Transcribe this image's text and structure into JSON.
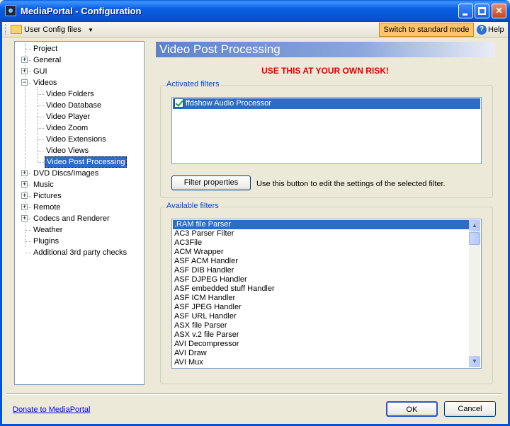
{
  "window": {
    "title": "MediaPortal - Configuration"
  },
  "toolbar": {
    "user_config": "User Config files",
    "switch_mode": "Switch to standard mode",
    "help": "Help"
  },
  "tree": {
    "items": [
      {
        "label": "Project",
        "expander": ""
      },
      {
        "label": "General",
        "expander": "+"
      },
      {
        "label": "GUI",
        "expander": "+"
      },
      {
        "label": "Videos",
        "expander": "−"
      },
      {
        "label": "Video Folders",
        "expander": ""
      },
      {
        "label": "Video Database",
        "expander": ""
      },
      {
        "label": "Video Player",
        "expander": ""
      },
      {
        "label": "Video Zoom",
        "expander": ""
      },
      {
        "label": "Video Extensions",
        "expander": ""
      },
      {
        "label": "Video Views",
        "expander": ""
      },
      {
        "label": "Video Post Processing",
        "expander": ""
      },
      {
        "label": "DVD Discs/Images",
        "expander": "+"
      },
      {
        "label": "Music",
        "expander": "+"
      },
      {
        "label": "Pictures",
        "expander": "+"
      },
      {
        "label": "Remote",
        "expander": "+"
      },
      {
        "label": "Codecs and Renderer",
        "expander": "+"
      },
      {
        "label": "Weather",
        "expander": ""
      },
      {
        "label": "Plugins",
        "expander": ""
      },
      {
        "label": "Additional 3rd party checks",
        "expander": ""
      }
    ],
    "selected": "Video Post Processing"
  },
  "content": {
    "header": "Video Post Processing",
    "warning": "USE THIS AT YOUR OWN RISK!",
    "activated_filters": {
      "title": "Activated filters",
      "items": [
        {
          "label": "ffdshow Audio Processor",
          "checked": true
        }
      ]
    },
    "filter_properties_button": "Filter properties",
    "filter_properties_hint": "Use this button to edit the settings of the selected filter.",
    "available_filters": {
      "title": "Available filters",
      "items": [
        ".RAM file Parser",
        "AC3 Parser Filter",
        "AC3File",
        "ACM Wrapper",
        "ASF ACM Handler",
        "ASF DIB Handler",
        "ASF DJPEG Handler",
        "ASF embedded stuff Handler",
        "ASF ICM Handler",
        "ASF JPEG Handler",
        "ASF URL Handler",
        "ASX file Parser",
        "ASX v.2 file Parser",
        "AVI Decompressor",
        "AVI Draw",
        "AVI Mux"
      ],
      "selected": ".RAM file Parser"
    }
  },
  "footer": {
    "donate": "Donate to MediaPortal",
    "ok": "OK",
    "cancel": "Cancel"
  },
  "colors": {
    "selection": "#316ac5",
    "warning": "#e00000",
    "group_title": "#0046d5",
    "switch_button": "#ffc36a"
  }
}
